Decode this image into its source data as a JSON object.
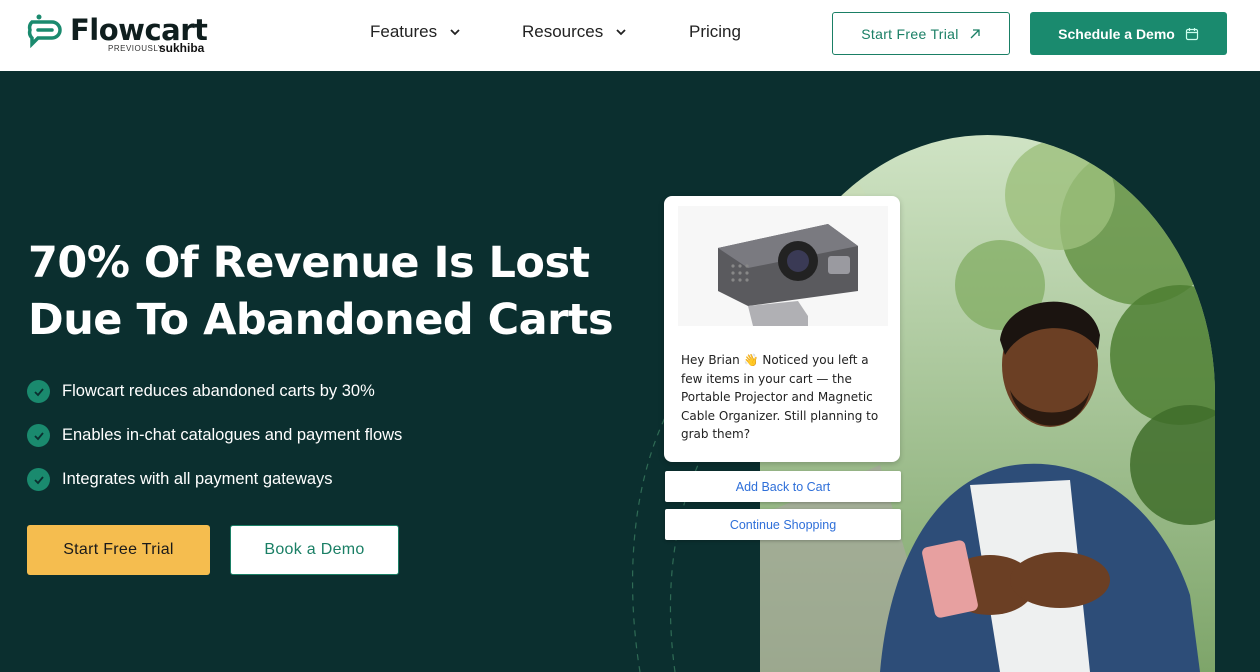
{
  "brand": {
    "name": "Flowcart",
    "previously_label": "PREVIOUSLY",
    "previously_name": "sukhiba",
    "color": "#1a8a6e"
  },
  "nav": {
    "items": [
      {
        "label": "Features",
        "has_dropdown": true
      },
      {
        "label": "Resources",
        "has_dropdown": true
      },
      {
        "label": "Pricing",
        "has_dropdown": false
      }
    ]
  },
  "header_buttons": {
    "trial_label": "Start Free Trial",
    "trial_icon": "arrow-up-right-icon",
    "demo_label": "Schedule a Demo",
    "demo_icon": "calendar-icon"
  },
  "hero": {
    "headline_line1": "70% Of Revenue Is Lost",
    "headline_line2": "Due To Abandoned Carts",
    "features": [
      "Flowcart reduces abandoned carts by 30%",
      "Enables in-chat catalogues and payment flows",
      "Integrates with all payment gateways"
    ],
    "cta_primary": "Start Free Trial",
    "cta_secondary": "Book a Demo",
    "background": "#0b2f2f",
    "accent_yellow": "#f5bd4f"
  },
  "chat": {
    "message": "Hey Brian 👋 Noticed you left a few items in your cart — the Portable Projector and Magnetic Cable Organizer. Still planning to grab them?",
    "buttons": [
      "Add Back to Cart",
      "Continue Shopping"
    ],
    "link_color": "#2e6fd9"
  }
}
